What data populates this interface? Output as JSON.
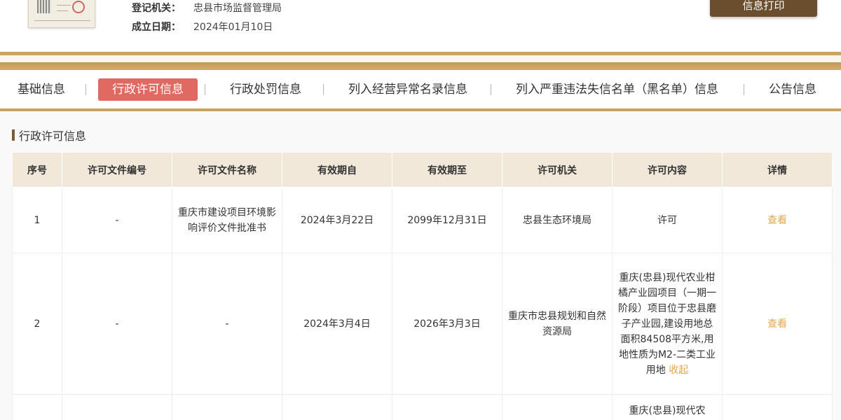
{
  "company": {
    "registration_authority_label": "登记机关：",
    "registration_authority_value": "忠县市场监督管理局",
    "established_date_label": "成立日期：",
    "established_date_value": "2024年01月10日"
  },
  "actions": {
    "print_label": "信息打印"
  },
  "tabs": [
    {
      "label": "基础信息"
    },
    {
      "label": "行政许可信息",
      "active": true
    },
    {
      "label": "行政处罚信息"
    },
    {
      "label": "列入经营异常名录信息"
    },
    {
      "label": "列入严重违法失信名单（黑名单）信息"
    },
    {
      "label": "公告信息"
    }
  ],
  "section": {
    "title": "行政许可信息"
  },
  "table": {
    "headers": [
      "序号",
      "许可文件编号",
      "许可文件名称",
      "有效期自",
      "有效期至",
      "许可机关",
      "许可内容",
      "详情"
    ],
    "rows": [
      {
        "index": "1",
        "doc_no": "-",
        "doc_name": "重庆市建设项目环境影响评价文件批准书",
        "valid_from": "2024年3月22日",
        "valid_to": "2099年12月31日",
        "authority": "忠县生态环境局",
        "content": "许可",
        "detail": "查看"
      },
      {
        "index": "2",
        "doc_no": "-",
        "doc_name": "-",
        "valid_from": "2024年3月4日",
        "valid_to": "2026年3月3日",
        "authority": "重庆市忠县规划和自然资源局",
        "content": "重庆(忠县)现代农业柑橘产业园项目（一期一阶段）项目位于忠县磨子产业园,建设用地总面积84508平方米,用地性质为M2-二类工业用地",
        "collapse": "收起",
        "detail": "查看"
      },
      {
        "index": "",
        "doc_no": "",
        "doc_name": "",
        "valid_from": "",
        "valid_to": "",
        "authority": "",
        "content": "重庆(忠县)现代农",
        "detail": ""
      }
    ]
  },
  "colors": {
    "gold": "#c9a45e",
    "brown_button": "#6b4e2e",
    "active_tab": "#e06a61",
    "link": "#e3a74c",
    "table_header": "#f1e8d9"
  }
}
